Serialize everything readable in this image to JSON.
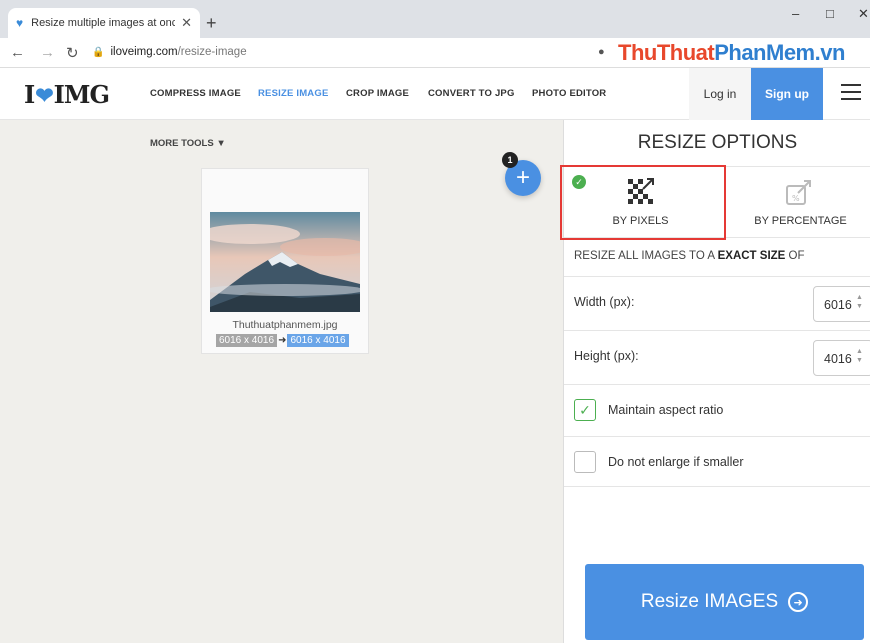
{
  "browser": {
    "tab_title": "Resize multiple images at once!",
    "url_host": "iloveimg.com",
    "url_path": "/resize-image",
    "watermark_red": "ThuThuat",
    "watermark_blue": "PhanMem",
    "watermark_suffix": ".vn"
  },
  "header": {
    "logo_left": "I",
    "logo_right": "IMG",
    "nav": [
      "COMPRESS IMAGE",
      "RESIZE IMAGE",
      "CROP IMAGE",
      "CONVERT TO JPG",
      "PHOTO EDITOR"
    ],
    "active_nav": "RESIZE IMAGE",
    "login": "Log in",
    "signup": "Sign up"
  },
  "workarea": {
    "more_tools": "MORE TOOLS",
    "file_count_badge": "1",
    "file": {
      "name": "Thuthuatphanmem.jpg",
      "original_size": "6016 x 4016",
      "new_size": "6016 x 4016"
    }
  },
  "panel": {
    "title": "RESIZE OPTIONS",
    "mode_pixels": "BY PIXELS",
    "mode_percentage": "BY PERCENTAGE",
    "desc_prefix": "RESIZE ALL IMAGES TO A ",
    "desc_bold": "EXACT SIZE",
    "desc_suffix": " OF",
    "width_label": "Width (px):",
    "width_value": "6016",
    "height_label": "Height (px):",
    "height_value": "4016",
    "maintain_label": "Maintain aspect ratio",
    "maintain_checked": true,
    "noenlarge_label": "Do not enlarge if smaller",
    "noenlarge_checked": false,
    "resize_button": "Resize IMAGES"
  },
  "colors": {
    "accent": "#4a90e2",
    "highlight_box": "#e53935",
    "check_green": "#4caf50"
  }
}
